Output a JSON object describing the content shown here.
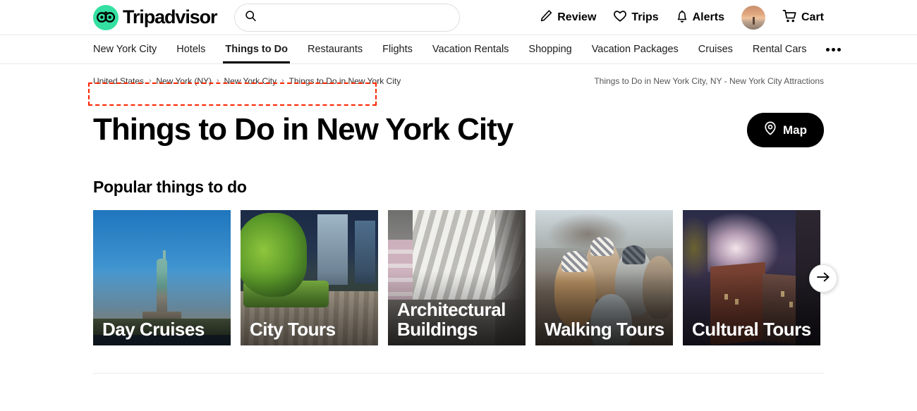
{
  "brand": {
    "name": "Tripadvisor",
    "logo_icon": "owl-logo-icon",
    "logo_color": "#34e0a1"
  },
  "search": {
    "value": "",
    "placeholder": "",
    "icon": "search-icon"
  },
  "header": {
    "actions": [
      {
        "label": "Review",
        "icon": "pencil-icon"
      },
      {
        "label": "Trips",
        "icon": "heart-icon"
      },
      {
        "label": "Alerts",
        "icon": "bell-icon"
      }
    ],
    "avatar": {
      "icon": "avatar"
    },
    "cart": {
      "label": "Cart",
      "icon": "cart-icon"
    }
  },
  "nav": {
    "items": [
      {
        "label": "New York City",
        "active": false
      },
      {
        "label": "Hotels",
        "active": false
      },
      {
        "label": "Things to Do",
        "active": true
      },
      {
        "label": "Restaurants",
        "active": false
      },
      {
        "label": "Flights",
        "active": false
      },
      {
        "label": "Vacation Rentals",
        "active": false
      },
      {
        "label": "Shopping",
        "active": false
      },
      {
        "label": "Vacation Packages",
        "active": false
      },
      {
        "label": "Cruises",
        "active": false
      },
      {
        "label": "Rental Cars",
        "active": false
      }
    ],
    "more_icon": "ellipsis-icon"
  },
  "breadcrumb": {
    "items": [
      "United States",
      "New York (NY)",
      "New York City",
      "Things to Do in New York City"
    ],
    "separator": "›",
    "highlight_color": "#ff2400"
  },
  "tagline": "Things to Do in New York City, NY - New York City Attractions",
  "page": {
    "title": "Things to Do in New York City",
    "map_button": {
      "label": "Map",
      "icon": "map-pin-icon"
    }
  },
  "popular": {
    "heading": "Popular things to do",
    "cards": [
      {
        "label": "Day Cruises",
        "art": "art-liberty"
      },
      {
        "label": "City Tours",
        "art": "art-highline"
      },
      {
        "label": "Architectural Buildings",
        "art": "art-oculus"
      },
      {
        "label": "Walking Tours",
        "art": "art-walk"
      },
      {
        "label": "Cultural Tours",
        "art": "art-cult"
      }
    ],
    "next_icon": "arrow-right-icon"
  }
}
